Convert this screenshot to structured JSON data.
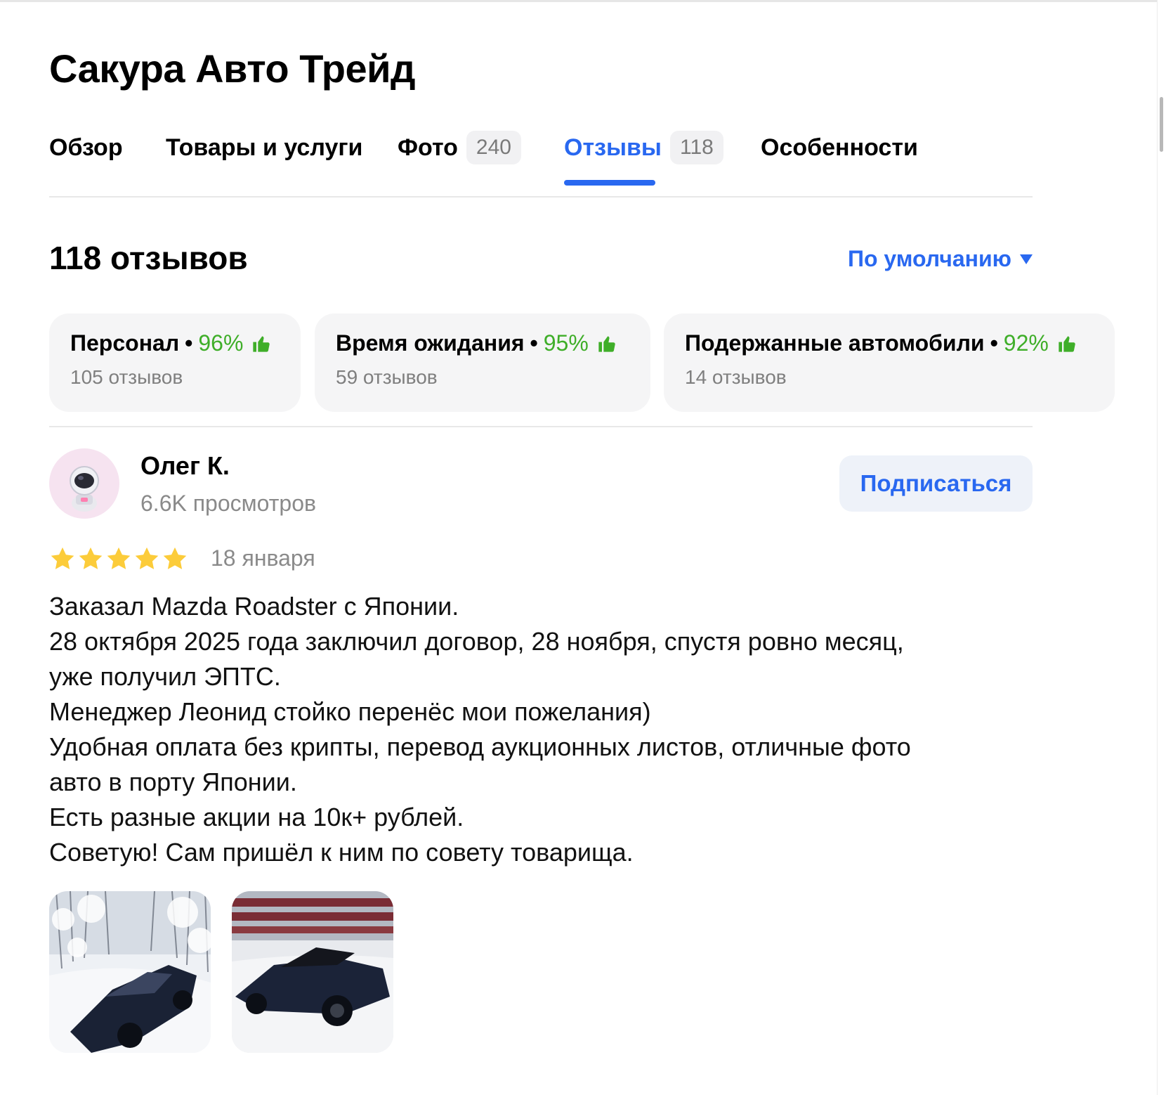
{
  "business": {
    "name": "Сакура Авто Трейд"
  },
  "tabs": [
    {
      "label": "Обзор",
      "count": null,
      "active": false
    },
    {
      "label": "Товары и услуги",
      "count": null,
      "active": false
    },
    {
      "label": "Фото",
      "count": "240",
      "active": false
    },
    {
      "label": "Отзывы",
      "count": "118",
      "active": true
    },
    {
      "label": "Особенности",
      "count": null,
      "active": false
    }
  ],
  "reviews": {
    "count_label": "118 отзывов",
    "sort_label": "По умолчанию"
  },
  "aspects": [
    {
      "name": "Персонал",
      "separator": "•",
      "percent": "96%",
      "reviews": "105 отзывов"
    },
    {
      "name": "Время ожидания",
      "separator": "•",
      "percent": "95%",
      "reviews": "59 отзывов"
    },
    {
      "name": "Подержанные автомобили",
      "separator": "•",
      "percent": "92%",
      "reviews": "14 отзывов"
    }
  ],
  "review": {
    "author": "Олег К.",
    "views": "6.6K просмотров",
    "subscribe_label": "Подписаться",
    "rating": 5,
    "date": "18 января",
    "text_lines": [
      "Заказал Mazda Roadster с Японии.",
      "28 октября 2025 года заключил договор, 28 ноября, спустя ровно месяц,",
      "уже получил ЭПТС.",
      "Менеджер Леонид стойко перенёс мои пожелания)",
      "Удобная оплата без крипты, перевод аукционных листов, отличные фото",
      "авто в порту Японии.",
      "Есть разные акции на 10к+ рублей.",
      "Советую! Сам пришёл к ним по совету товарища."
    ],
    "photos": [
      "car-photo-snow-road",
      "car-photo-parking"
    ]
  },
  "colors": {
    "accent": "#2968f0",
    "positive": "#3fae29",
    "star": "#fccc3a",
    "card_bg": "#f5f5f6",
    "muted_text": "#8a8a8a"
  },
  "icons": {
    "thumbs_up": "thumbs-up-icon",
    "star": "star-icon",
    "sort": "chevron-down-icon",
    "avatar": "astronaut-avatar-icon"
  }
}
